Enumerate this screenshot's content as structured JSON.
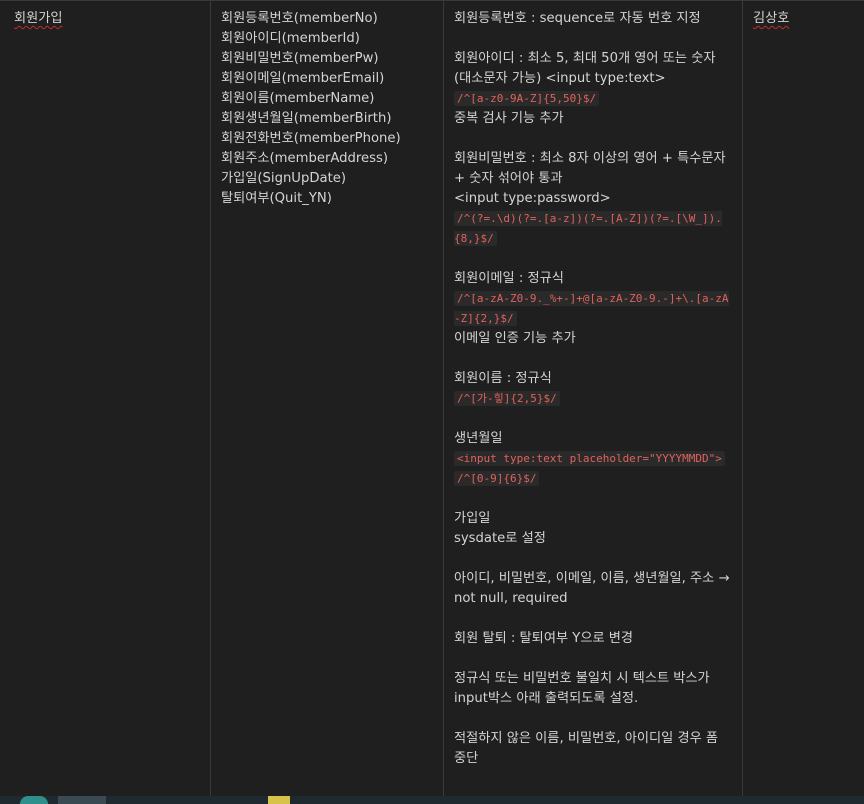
{
  "col1": {
    "title": "회원가입"
  },
  "col2": {
    "items": [
      "회원등록번호(memberNo)",
      "회원아이디(memberId)",
      "회원비밀번호(memberPw)",
      "회원이메일(memberEmail)",
      "회원이름(memberName)",
      "회원생년월일(memberBirth)",
      "회원전화번호(memberPhone)",
      "회원주소(memberAddress)",
      "가입일(SignUpDate)",
      "탈퇴여부(Quit_YN)"
    ]
  },
  "col3": {
    "no_label": "회원등록번호 : sequence로 자동 번호 지정",
    "id_desc": "회원아이디 : 최소 5, 최대 50개 영어 또는 숫자(대소문자 가능) <input type:text>",
    "id_regex": "/^[a-z0-9A-Z]{5,50}$/",
    "id_note": "중복 검사 기능 추가",
    "pw_desc": "회원비밀번호 : 최소 8자 이상의 영어 + 특수문자 + 숫자 섞어야 통과",
    "pw_input": "<input type:password>",
    "pw_regex": "/^(?=.\\d)(?=.[a-z])(?=.[A-Z])(?=.[\\W_]).{8,}$/",
    "email_desc": "회원이메일 : 정규식",
    "email_regex": "/^[a-zA-Z0-9._%+-]+@[a-zA-Z0-9.-]+\\.[a-zA-Z]{2,}$/",
    "email_note": "이메일 인증 기능 추가",
    "name_desc": "회원이름 : 정규식",
    "name_regex": "/^[가-힣]{2,5}$/",
    "birth_label": "생년월일",
    "birth_input": "<input type:text placeholder=\"YYYYMMDD\">",
    "birth_regex": "/^[0-9]{6}$/",
    "signup_label": "가입일",
    "signup_note": "sysdate로 설정",
    "required_note": "아이디, 비밀번호, 이메일, 이름, 생년월일, 주소 → not null, required",
    "quit_note": "회원 탈퇴 : 탈퇴여부 Y으로 변경",
    "mismatch_note": "정규식 또는 비밀번호 불일치 시 텍스트 박스가 input박스 아래 출력되도록 설정.",
    "stop_note": "적절하지 않은 이름, 비밀번호, 아이디일 경우 폼 중단"
  },
  "col4": {
    "assignee": "김상호"
  },
  "colors": {
    "background": "#1f1f1f",
    "code": "#e0625c",
    "squiggle": "#b8312f",
    "taskbar": "#1e2a30"
  }
}
